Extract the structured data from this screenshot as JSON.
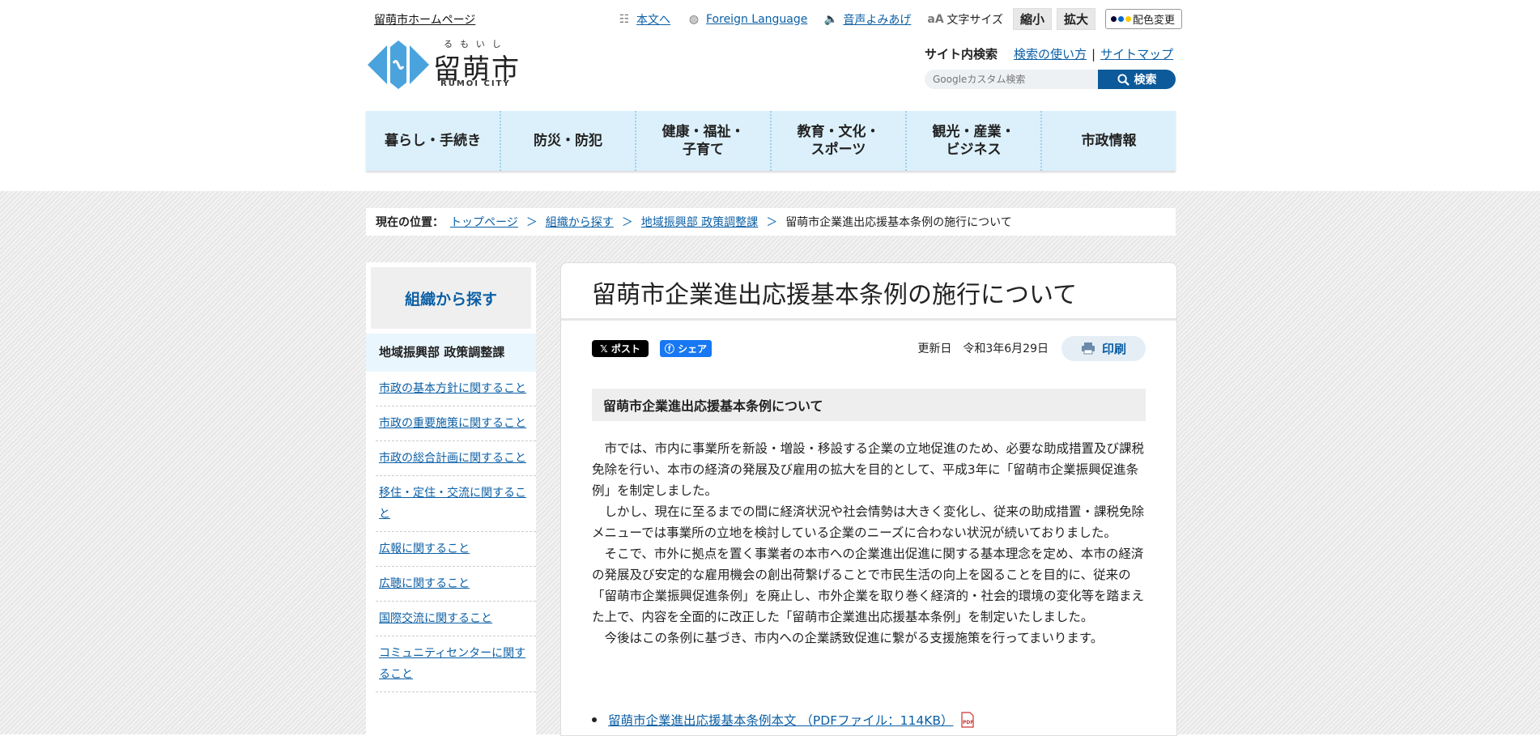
{
  "header": {
    "home_link": "留萌市ホームページ",
    "util": {
      "skip": "本文へ",
      "foreign": "Foreign Language",
      "voice": "音声よみあげ",
      "font_size_label": "文字サイズ",
      "shrink": "縮小",
      "enlarge": "拡大",
      "color_change": "配色変更"
    },
    "logo": {
      "ruby": "るもいし",
      "text": "留萌市",
      "en": "RUMOI CITY"
    },
    "search": {
      "label": "サイト内検索",
      "howto": "検索の使い方",
      "sitemap": "サイトマップ",
      "placeholder": "Googleカスタム検索",
      "button": "検索"
    }
  },
  "nav": [
    "暮らし・手続き",
    "防災・防犯",
    "健康・福祉・\n子育て",
    "教育・文化・\nスポーツ",
    "観光・産業・\nビジネス",
    "市政情報"
  ],
  "breadcrumb": {
    "label": "現在の位置：",
    "items": [
      "トップページ",
      "組織から探す",
      "地域振興部 政策調整課"
    ],
    "current": "留萌市企業進出応援基本条例の施行について"
  },
  "sidebar": {
    "title": "組織から探す",
    "current": "地域振興部 政策調整課",
    "items": [
      "市政の基本方針に関すること",
      "市政の重要施策に関すること",
      "市政の総合計画に関すること",
      "移住・定住・交流に関すること",
      "広報に関すること",
      "広聴に関すること",
      "国際交流に関すること",
      "コミュニティセンターに関すること"
    ]
  },
  "main": {
    "title": "留萌市企業進出応援基本条例の施行について",
    "share": {
      "x": "ポスト",
      "fb": "シェア"
    },
    "updated_label": "更新日",
    "updated_date": "令和3年6月29日",
    "print": "印刷",
    "section_heading": "留萌市企業進出応援基本条例について",
    "paragraphs": [
      "市では、市内に事業所を新設・増設・移設する企業の立地促進のため、必要な助成措置及び課税免除を行い、本市の経済の発展及び雇用の拡大を目的として、平成3年に「留萌市企業振興促進条例」を制定しました。",
      "しかし、現在に至るまでの間に経済状況や社会情勢は大きく変化し、従来の助成措置・課税免除メニューでは事業所の立地を検討している企業のニーズに合わない状況が続いておりました。",
      "そこで、市外に拠点を置く事業者の本市への企業進出促進に関する基本理念を定め、本市の経済の発展及び安定的な雇用機会の創出荷繋げることで市民生活の向上を図ることを目的に、従来の「留萌市企業振興促進条例」を廃止し、市外企業を取り巻く経済的・社会的環境の変化等を踏まえた上で、内容を全面的に改正した「留萌市企業進出応援基本条例」を制定いたしました。",
      "今後はこの条例に基づき、市内への企業誘致促進に繋がる支援施策を行ってまいります。"
    ],
    "document_link": "留萌市企業進出応援基本条例本文 （PDFファイル：114KB）"
  },
  "colors": {
    "accent": "#0b5fa5",
    "nav_bg": "#dcf0fb",
    "logo_blue": "#4aa3dc"
  }
}
